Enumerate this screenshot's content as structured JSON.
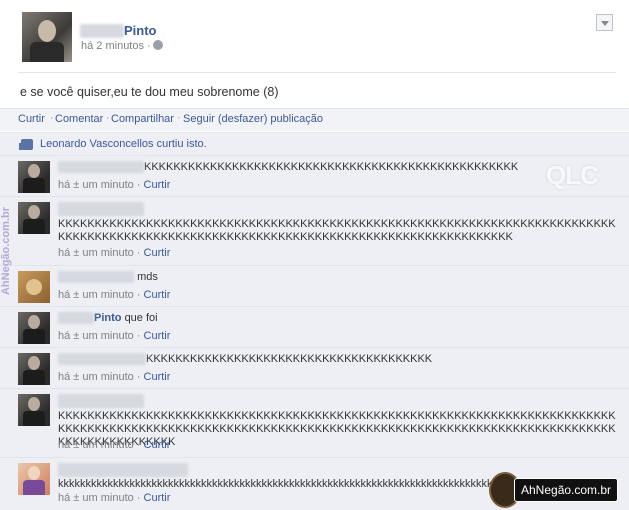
{
  "post": {
    "author": "Pinto",
    "time": "há 2 minutos ·",
    "text": "e se você quiser,eu te dou meu sobrenome (8)"
  },
  "actions": {
    "like": "Curtir",
    "comment": "Comentar",
    "share": "Compartilhar",
    "follow": "Seguir (desfazer) publicação",
    "sep": "·"
  },
  "likes": {
    "text": "Leonardo Vasconcellos curtiu isto."
  },
  "comments": [
    {
      "text": "KKKKKKKKKKKKKKKKKKKKKKKKKKKKKKKKKKKKKKKKKKKKKKKKKKK",
      "time": "há ± um minuto",
      "like": "Curtir"
    },
    {
      "text": "KKKKKKKKKKKKKKKKKKKKKKKKKKKKKKKKKKKKKKKKKKKKKKKKKKKKKKKKKKKKKKKKKKKKKKKKKKKKKKKKKKKKKKKKKKKKKKKKKKKKKKKKKKKKKKKKKKKKKKKKKKKKKKKKKKKKKKKKKK",
      "time": "há ± um minuto",
      "like": "Curtir"
    },
    {
      "text": "mds",
      "time": "há ± um minuto",
      "like": "Curtir"
    },
    {
      "name": "Pinto",
      "text": "que foi",
      "time": "há ± um minuto",
      "like": "Curtir"
    },
    {
      "text": "KKKKKKKKKKKKKKKKKKKKKKKKKKKKKKKKKKKKKKK",
      "time": "há ± um minuto",
      "like": "Curtir"
    },
    {
      "text": "KKKKKKKKKKKKKKKKKKKKKKKKKKKKKKKKKKKKKKKKKKKKKKKKKKKKKKKKKKKKKKKKKKKKKKKKKKKKKKKKKKKKKKKKKKKKKKKKKKKKKKKKKKKKKKKKKKKKKKKKKKKKKKKKKKKKKKKKKKKKKKKKKKKKKKKKKKKKKKKKKKKKKKKK",
      "time": "há ± um minuto",
      "like": "Curtir"
    },
    {
      "text": "kkkkkkkkkkkkkkkkkkkkkkkkkkkkkkkkkkkkkkkkkkkkkkkkkkkkkkkkkkkkkkkkkkkkkkkkkkkkkkkkkkkkkkkk",
      "time": "há ± um minuto",
      "like": "Curtir"
    }
  ],
  "watermarks": {
    "qlc": "QLC",
    "side": "AhNegão.com.br",
    "brand": "AhNegão.com.br"
  },
  "colors": {
    "link": "#3b5998",
    "comment_bg": "#edeff4",
    "muted": "#808080"
  }
}
